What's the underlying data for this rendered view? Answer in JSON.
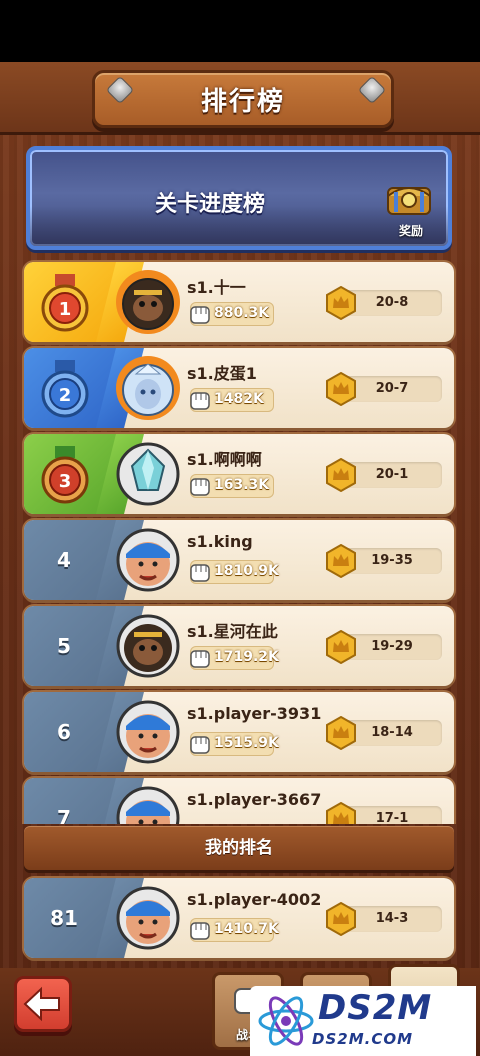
{
  "header": {
    "title": "排行榜"
  },
  "banner": {
    "title": "关卡进度榜",
    "reward_label": "奖励"
  },
  "rows": [
    {
      "rank": "1",
      "medal": "gold-medal-icon",
      "name": "s1.十一",
      "power": "880.3K",
      "level": "20-8",
      "avatar": "monkey-king-flame-avatar"
    },
    {
      "rank": "2",
      "medal": "blue-medal-icon",
      "name": "s1.皮蛋1",
      "power": "1482K",
      "level": "20-7",
      "avatar": "ice-queen-flame-avatar"
    },
    {
      "rank": "3",
      "medal": "red-medal-icon",
      "name": "s1.啊啊啊",
      "power": "163.3K",
      "level": "20-1",
      "avatar": "crystal-knight-avatar"
    },
    {
      "rank": "4",
      "name": "s1.king",
      "power": "1810.9K",
      "level": "19-35",
      "avatar": "blue-bandana-brawler-avatar"
    },
    {
      "rank": "5",
      "name": "s1.星河在此",
      "power": "1719.2K",
      "level": "19-29",
      "avatar": "monkey-king-avatar"
    },
    {
      "rank": "6",
      "name": "s1.player-3931",
      "power": "1515.9K",
      "level": "18-14",
      "avatar": "blue-bandana-brawler-avatar"
    },
    {
      "rank": "7",
      "name": "s1.player-3667",
      "power": "",
      "level": "17-1",
      "avatar": "blue-bandana-brawler-avatar"
    }
  ],
  "my_rank": {
    "label": "我的排名",
    "row": {
      "rank": "81",
      "name": "s1.player-4002",
      "power": "1410.7K",
      "level": "14-3",
      "avatar": "blue-bandana-brawler-avatar"
    }
  },
  "bottom_nav": {
    "tab1_label": "战斗",
    "tab2_label": "",
    "tab3_label": ""
  },
  "watermark": {
    "brand": "DS2M",
    "site": "DS2M.COM"
  },
  "colors": {
    "gold": "#f5a90e",
    "blue": "#2f66c8",
    "green": "#5aa72c",
    "plain": "#5a7390",
    "power_text": "#fff",
    "accent_banner": "#4f7fd8"
  }
}
